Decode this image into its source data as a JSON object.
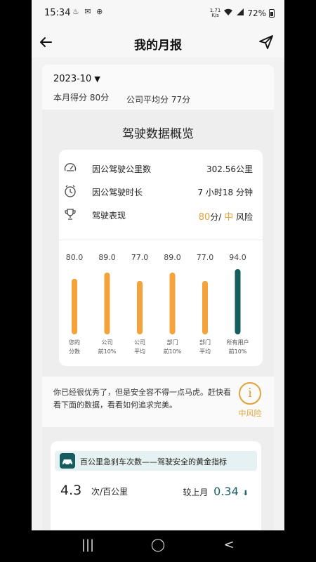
{
  "status_bar": {
    "time": "15:34",
    "net_speed_value": "1.71",
    "net_speed_unit": "K/s",
    "battery": "72%"
  },
  "header": {
    "title": "我的月报"
  },
  "report": {
    "period": "2023-10",
    "my_score_label": "本月得分 80分",
    "company_avg_label": "公司平均分 77分",
    "overview_title": "驾驶数据概览",
    "stats": [
      {
        "icon": "speedometer-icon",
        "label": "因公驾驶公里数",
        "value": "302.56公里"
      },
      {
        "icon": "clock-icon",
        "label": "因公驾驶时长",
        "value": "7 小时18 分钟"
      },
      {
        "icon": "trophy-icon",
        "label": "驾驶表现",
        "score": "80",
        "score_unit": "分/",
        "level": "中",
        "level_unit": " 风险"
      }
    ],
    "tip_text": "你已经很优秀了，但是安全容不得一点马虎。赶快看看下面的数据，看看如何追求完美。",
    "risk_icon_glyph": "i",
    "risk_label": "中风险",
    "brake": {
      "banner_text": "百公里急刹车次数——驾驶安全的黄金指标",
      "value": "4.3",
      "unit": "次/百公里",
      "compare_label": "较上月",
      "compare_value": "0.34",
      "compare_arrow": "⬇"
    }
  },
  "chart_data": {
    "type": "bar",
    "categories": [
      [
        "您的",
        "分数"
      ],
      [
        "公司",
        "前10%"
      ],
      [
        "公司",
        "平均"
      ],
      [
        "部门",
        "前10%"
      ],
      [
        "部门",
        "平均"
      ],
      [
        "所有用户",
        "前10%"
      ]
    ],
    "values": [
      80.0,
      89.0,
      77.0,
      89.0,
      77.0,
      94.0
    ],
    "value_labels": [
      "80.0",
      "89.0",
      "77.0",
      "89.0",
      "77.0",
      "94.0"
    ],
    "colors": [
      "#f3a33a",
      "#f3a33a",
      "#f3a33a",
      "#f3a33a",
      "#f3a33a",
      "#155d5f"
    ],
    "ylim": [
      0,
      94
    ]
  },
  "colors": {
    "accent_orange": "#f3a33a",
    "accent_teal": "#155d5f",
    "risk_orange": "#e0a23a"
  },
  "nav": {
    "recent_glyph": "|||",
    "home_glyph": "◯",
    "back_glyph": "<"
  }
}
